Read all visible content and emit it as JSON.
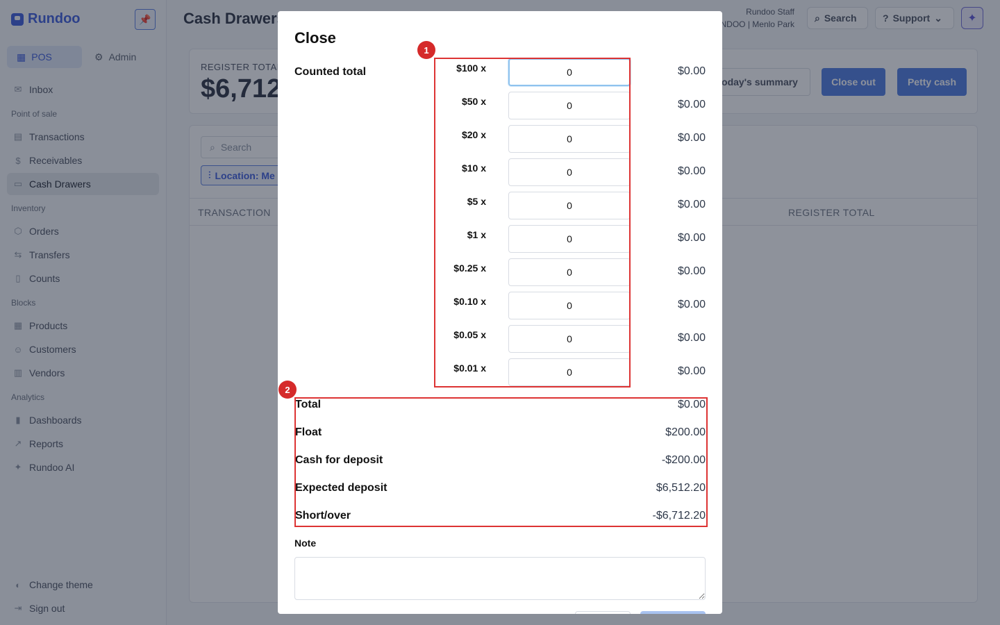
{
  "app": {
    "brand": "Rundoo"
  },
  "sidebar": {
    "modes": [
      {
        "label": "POS"
      },
      {
        "label": "Admin"
      }
    ],
    "inbox": "Inbox",
    "sections": [
      {
        "title": "Point of sale",
        "items": [
          "Transactions",
          "Receivables",
          "Cash Drawers"
        ]
      },
      {
        "title": "Inventory",
        "items": [
          "Orders",
          "Transfers",
          "Counts"
        ]
      },
      {
        "title": "Blocks",
        "items": [
          "Products",
          "Customers",
          "Vendors"
        ]
      },
      {
        "title": "Analytics",
        "items": [
          "Dashboards",
          "Reports",
          "Rundoo AI"
        ]
      }
    ],
    "bottom": [
      "Change theme",
      "Sign out"
    ]
  },
  "header": {
    "title": "Cash Drawers",
    "staff_name": "Rundoo Staff",
    "staff_location": "NDOO | Menlo Park",
    "search_label": "Search",
    "support_label": "Support"
  },
  "register": {
    "label": "REGISTER TOTAL",
    "value": "$6,712",
    "summary_button": "oday's summary",
    "close_out_button": "Close out",
    "petty_cash_button": "Petty cash"
  },
  "list": {
    "search_placeholder": "Search",
    "location_chip": "Location: Me",
    "columns": [
      "TRANSACTION",
      "REGISTER TOTAL"
    ]
  },
  "modal": {
    "title": "Close",
    "counted_label": "Counted total",
    "denominations": [
      {
        "label": "$100 x",
        "count": "0",
        "amount": "$0.00"
      },
      {
        "label": "$50 x",
        "count": "0",
        "amount": "$0.00"
      },
      {
        "label": "$20 x",
        "count": "0",
        "amount": "$0.00"
      },
      {
        "label": "$10 x",
        "count": "0",
        "amount": "$0.00"
      },
      {
        "label": "$5 x",
        "count": "0",
        "amount": "$0.00"
      },
      {
        "label": "$1 x",
        "count": "0",
        "amount": "$0.00"
      },
      {
        "label": "$0.25 x",
        "count": "0",
        "amount": "$0.00"
      },
      {
        "label": "$0.10 x",
        "count": "0",
        "amount": "$0.00"
      },
      {
        "label": "$0.05 x",
        "count": "0",
        "amount": "$0.00"
      },
      {
        "label": "$0.01 x",
        "count": "0",
        "amount": "$0.00"
      }
    ],
    "summary": [
      {
        "label": "Total",
        "value": "$0.00"
      },
      {
        "label": "Float",
        "value": "$200.00"
      },
      {
        "label": "Cash for deposit",
        "value": "-$200.00"
      },
      {
        "label": "Expected deposit",
        "value": "$6,512.20"
      },
      {
        "label": "Short/over",
        "value": "-$6,712.20"
      }
    ],
    "note_label": "Note",
    "note_value": ""
  },
  "annotations": {
    "badge_1": "1",
    "badge_2": "2"
  },
  "colors": {
    "accent": "#3b5bdb",
    "primary_button": "#4c7ae0",
    "annotation_red": "#d52a2a",
    "overlay": "rgba(30,38,56,0.5)"
  },
  "icons": [
    "pin-icon",
    "grid-icon",
    "gear-icon",
    "inbox-icon",
    "receipt-icon",
    "dollar-icon",
    "cash-icon",
    "box-icon",
    "transfer-icon",
    "clipboard-icon",
    "products-icon",
    "customers-icon",
    "vendors-icon",
    "chart-icon",
    "trend-icon",
    "sparkle-icon",
    "theme-icon",
    "signout-icon",
    "search-icon",
    "help-icon",
    "chevron-down-icon",
    "filter-icon"
  ]
}
